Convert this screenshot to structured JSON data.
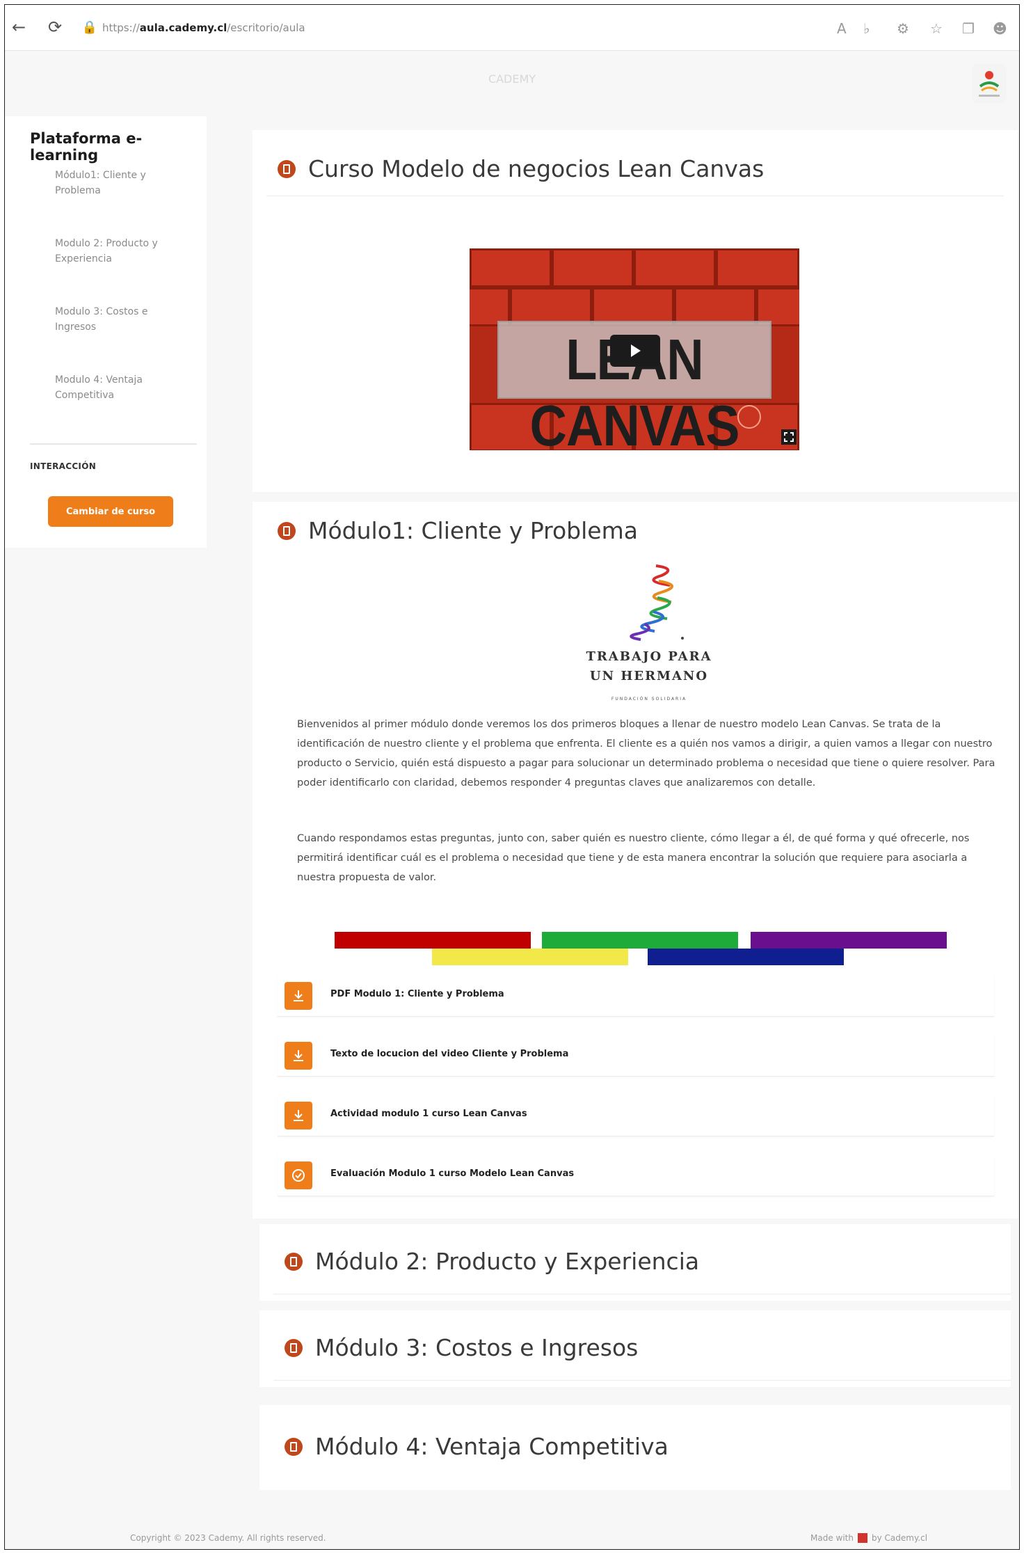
{
  "browser": {
    "url_prefix": "https://",
    "url_domain": "aula.cademy.cl",
    "url_path": "/escritorio/aula"
  },
  "site": {
    "title": "CADEMY"
  },
  "sidebar": {
    "title": "Plataforma e-learning",
    "items": [
      {
        "label": "Módulo1: Cliente y Problema"
      },
      {
        "label": "Modulo 2: Producto y Experiencia"
      },
      {
        "label": "Modulo 3: Costos e Ingresos"
      },
      {
        "label": "Modulo 4: Ventaja Competitiva"
      }
    ],
    "section_label": "INTERACCIÓN",
    "change_course_label": "Cambiar de curso"
  },
  "course": {
    "title": "Curso Modelo de negocios Lean Canvas",
    "video_text": "LEAN CANVAS"
  },
  "module1": {
    "title": "Módulo1: Cliente y Problema",
    "org_line1": "TRABAJO PARA",
    "org_line2": "UN HERMANO",
    "org_sub": "FUNDACIÓN SOLIDARIA",
    "paragraph1": "Bienvenidos al primer módulo donde veremos los dos primeros bloques a llenar de nuestro modelo Lean Canvas. Se trata de la identificación de nuestro cliente y el problema que enfrenta. El cliente es a quién nos vamos a dirigir, a quien vamos a llegar con nuestro producto o Servicio, quién está dispuesto a pagar para solucionar un determinado problema o necesidad que tiene o quiere resolver. Para poder identificarlo con claridad, debemos responder 4 preguntas claves que analizaremos con detalle.",
    "paragraph2": "Cuando respondamos estas preguntas, junto con, saber quién es nuestro cliente, cómo llegar a él, de qué forma y qué ofrecerle, nos permitirá identificar cuál es el problema o necesidad que tiene y de esta manera encontrar la solución que requiere para asociarla a nuestra propuesta de valor.",
    "resources": [
      {
        "label": "PDF Modulo 1: Cliente y Problema",
        "icon": "download-icon"
      },
      {
        "label": "Texto de locucion del video Cliente y Problema",
        "icon": "download-icon"
      },
      {
        "label": "Actividad modulo 1 curso Lean Canvas",
        "icon": "download-icon"
      },
      {
        "label": "Evaluación Modulo 1 curso Modelo Lean Canvas",
        "icon": "check-circle-icon"
      }
    ]
  },
  "modules_collapsed": [
    {
      "title": "Módulo 2: Producto y Experiencia"
    },
    {
      "title": "Módulo 3: Costos e Ingresos"
    },
    {
      "title": "Módulo 4: Ventaja Competitiva"
    }
  ],
  "footer": {
    "left": "Copyright © 2023 Cademy. All rights reserved.",
    "right_pre": "Made with",
    "right_post": "by Cademy.cl"
  },
  "colors": {
    "accent": "#ef7d1a",
    "stripe_red": "#c00000",
    "stripe_green": "#1fab3a",
    "stripe_purple": "#6a0f8e",
    "stripe_yellow": "#f2e84a",
    "stripe_navy": "#0f1f8f"
  }
}
